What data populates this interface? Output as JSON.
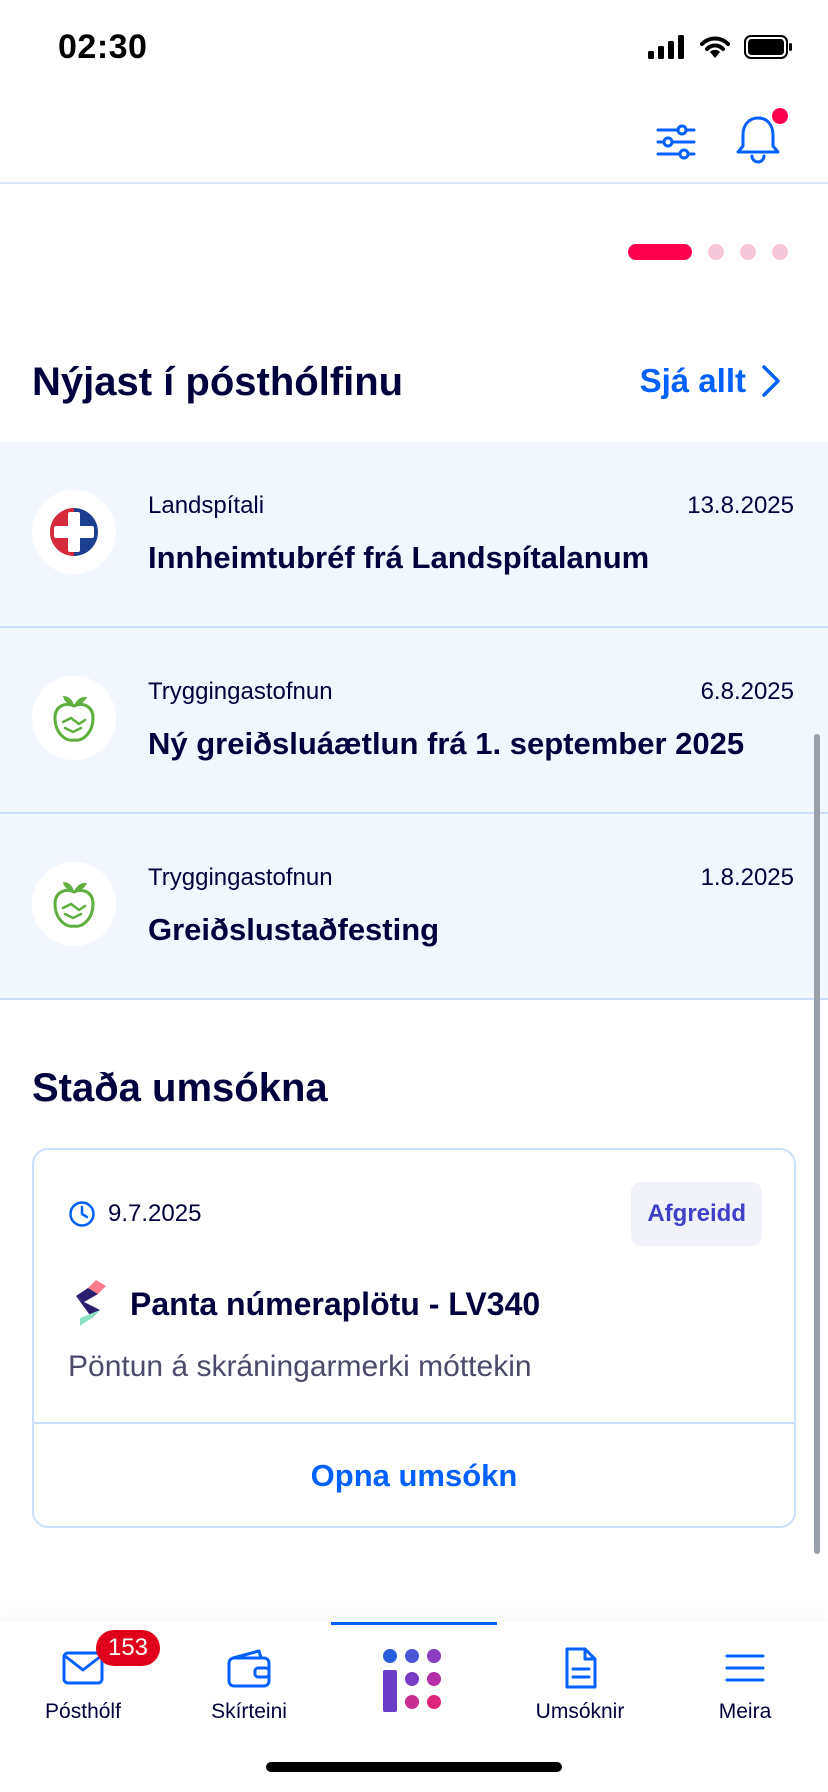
{
  "status_bar": {
    "time": "02:30"
  },
  "carousel": {
    "pages": 4,
    "active_index": 0
  },
  "inbox": {
    "title": "Nýjast í pósthólfinu",
    "see_all": "Sjá allt",
    "items": [
      {
        "sender": "Landspítali",
        "date": "13.8.2025",
        "subject": "Innheimtubréf frá Landspítalanum",
        "icon": "landspitali-logo"
      },
      {
        "sender": "Tryggingastofnun",
        "date": "6.8.2025",
        "subject": "Ný greiðsluáætlun frá 1. september 2025",
        "icon": "tryggingastofnun-logo"
      },
      {
        "sender": "Tryggingastofnun",
        "date": "1.8.2025",
        "subject": "Greiðslustaðfesting",
        "icon": "tryggingastofnun-logo"
      }
    ]
  },
  "applications": {
    "title": "Staða umsókna",
    "card": {
      "date": "9.7.2025",
      "status": "Afgreidd",
      "title": "Panta númeraplötu - LV340",
      "description": "Pöntun á skráningarmerki móttekin",
      "open_label": "Opna umsókn"
    }
  },
  "tab_bar": {
    "tabs": [
      {
        "label": "Pósthólf",
        "icon": "mail-icon",
        "badge": "153"
      },
      {
        "label": "Skírteini",
        "icon": "wallet-icon"
      },
      {
        "label": "",
        "icon": "island-logo-icon"
      },
      {
        "label": "Umsóknir",
        "icon": "document-icon"
      },
      {
        "label": "Meira",
        "icon": "menu-icon"
      }
    ],
    "active_index": 2
  },
  "colors": {
    "accent": "#0061ff",
    "notification": "#ff0050",
    "inbox_bg": "#f2f7ff",
    "text": "#00003c",
    "badge_red": "#e0001b"
  }
}
